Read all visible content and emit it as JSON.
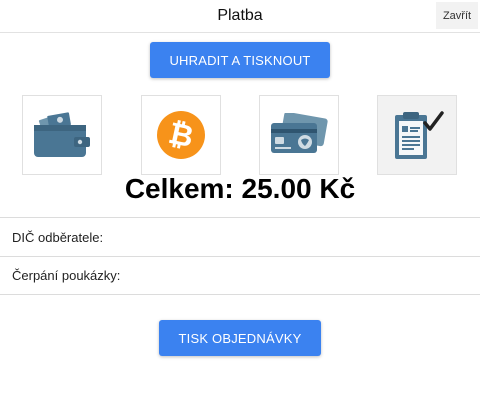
{
  "header": {
    "title": "Platba",
    "close_label": "Zavřít"
  },
  "actions": {
    "pay_print_label": "UHRADIT A TISKNOUT",
    "print_order_label": "TISK OBJEDNÁVKY"
  },
  "payment_methods": [
    {
      "icon": "wallet-icon",
      "selected": false
    },
    {
      "icon": "bitcoin-icon",
      "selected": false
    },
    {
      "icon": "cards-icon",
      "selected": false
    },
    {
      "icon": "invoice-clipboard-icon",
      "selected": true
    }
  ],
  "total": {
    "label": "Celkem:",
    "value": "25.00 Kč"
  },
  "fields": {
    "dic_label": "DIČ odběratele:",
    "voucher_label": "Čerpání poukázky:"
  },
  "colors": {
    "accent": "#3b82f0",
    "icon": "#4a7694",
    "bitcoin": "#f7931a"
  }
}
